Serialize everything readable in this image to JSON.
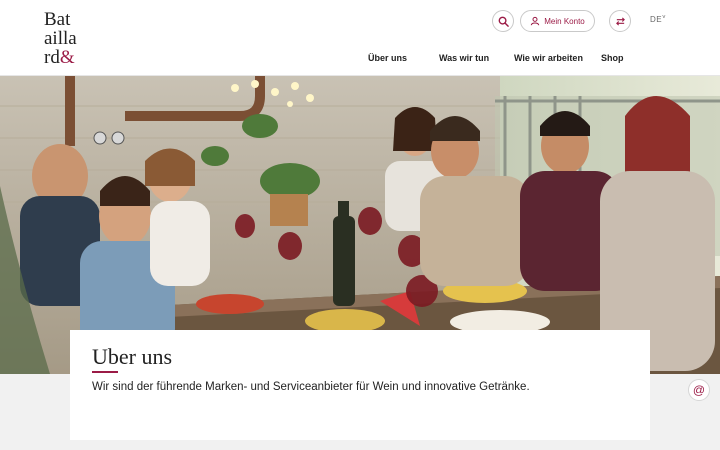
{
  "brand": {
    "logo_lines": [
      "Bat",
      "ailla",
      "rd"
    ],
    "logo_amp": "&",
    "accent": "#9b1b46"
  },
  "header": {
    "account_label": "Mein Konto",
    "language": "DE",
    "icons": [
      "search-icon",
      "user-icon",
      "swap-icon",
      "chevron-down-icon",
      "email-icon"
    ]
  },
  "nav": {
    "items": [
      {
        "label": "Über uns"
      },
      {
        "label": "Was wir tun"
      },
      {
        "label": "Wie wir arbeiten"
      },
      {
        "label": "Shop"
      }
    ]
  },
  "hero": {
    "alt": "Gruppe von Freunden beim Essen und Wein auf einer Terrasse"
  },
  "content": {
    "title": "Uber uns",
    "intro": "Wir sind der führende Marken- und Serviceanbieter für Wein und innovative Getränke."
  }
}
